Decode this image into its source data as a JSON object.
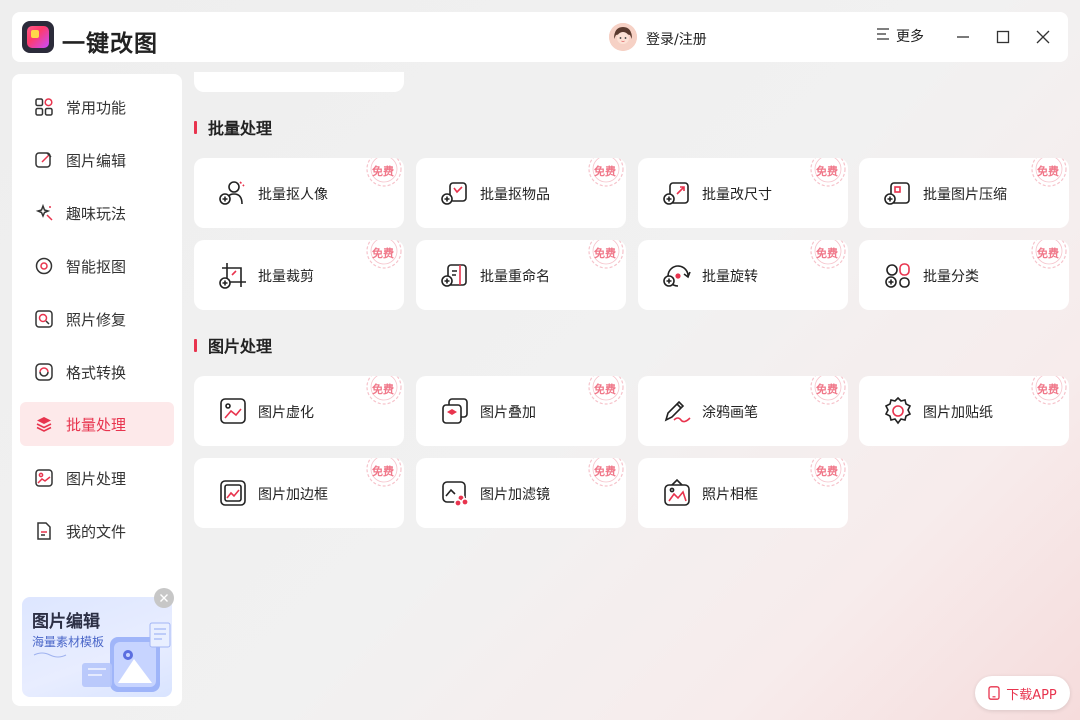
{
  "app": {
    "title": "一键改图"
  },
  "header": {
    "login": "登录/注册",
    "more": "更多"
  },
  "sidebar": {
    "items": [
      {
        "label": "常用功能",
        "icon": "grid-icon"
      },
      {
        "label": "图片编辑",
        "icon": "edit-icon"
      },
      {
        "label": "趣味玩法",
        "icon": "sparkle-icon"
      },
      {
        "label": "智能抠图",
        "icon": "target-icon"
      },
      {
        "label": "照片修复",
        "icon": "repair-icon"
      },
      {
        "label": "格式转换",
        "icon": "convert-icon"
      },
      {
        "label": "批量处理",
        "icon": "layers-icon",
        "active": true
      },
      {
        "label": "图片处理",
        "icon": "image-icon"
      },
      {
        "label": "我的文件",
        "icon": "file-icon"
      }
    ],
    "promo": {
      "title": "图片编辑",
      "subtitle": "海量素材模板"
    }
  },
  "sections": [
    {
      "title": "批量处理",
      "cards": [
        {
          "label": "批量抠人像",
          "badge": "免费",
          "icon": "batch-portrait-cutout-icon"
        },
        {
          "label": "批量抠物品",
          "badge": "免费",
          "icon": "batch-object-cutout-icon"
        },
        {
          "label": "批量改尺寸",
          "badge": "免费",
          "icon": "batch-resize-icon"
        },
        {
          "label": "批量图片压缩",
          "badge": "免费",
          "icon": "batch-compress-icon"
        },
        {
          "label": "批量裁剪",
          "badge": "免费",
          "icon": "batch-crop-icon"
        },
        {
          "label": "批量重命名",
          "badge": "免费",
          "icon": "batch-rename-icon"
        },
        {
          "label": "批量旋转",
          "badge": "免费",
          "icon": "batch-rotate-icon"
        },
        {
          "label": "批量分类",
          "badge": "免费",
          "icon": "batch-classify-icon"
        }
      ]
    },
    {
      "title": "图片处理",
      "cards": [
        {
          "label": "图片虚化",
          "badge": "免费",
          "icon": "blur-icon"
        },
        {
          "label": "图片叠加",
          "badge": "免费",
          "icon": "overlay-icon"
        },
        {
          "label": "涂鸦画笔",
          "badge": "免费",
          "icon": "brush-icon"
        },
        {
          "label": "图片加贴纸",
          "badge": "免费",
          "icon": "sticker-icon"
        },
        {
          "label": "图片加边框",
          "badge": "免费",
          "icon": "border-icon"
        },
        {
          "label": "图片加滤镜",
          "badge": "免费",
          "icon": "filter-icon"
        },
        {
          "label": "照片相框",
          "badge": "免费",
          "icon": "photo-frame-icon"
        }
      ]
    }
  ],
  "download": {
    "label": "下载APP"
  },
  "colors": {
    "accent": "#e8344e",
    "badge": "#f0788a",
    "active_bg": "#fde9ea"
  }
}
